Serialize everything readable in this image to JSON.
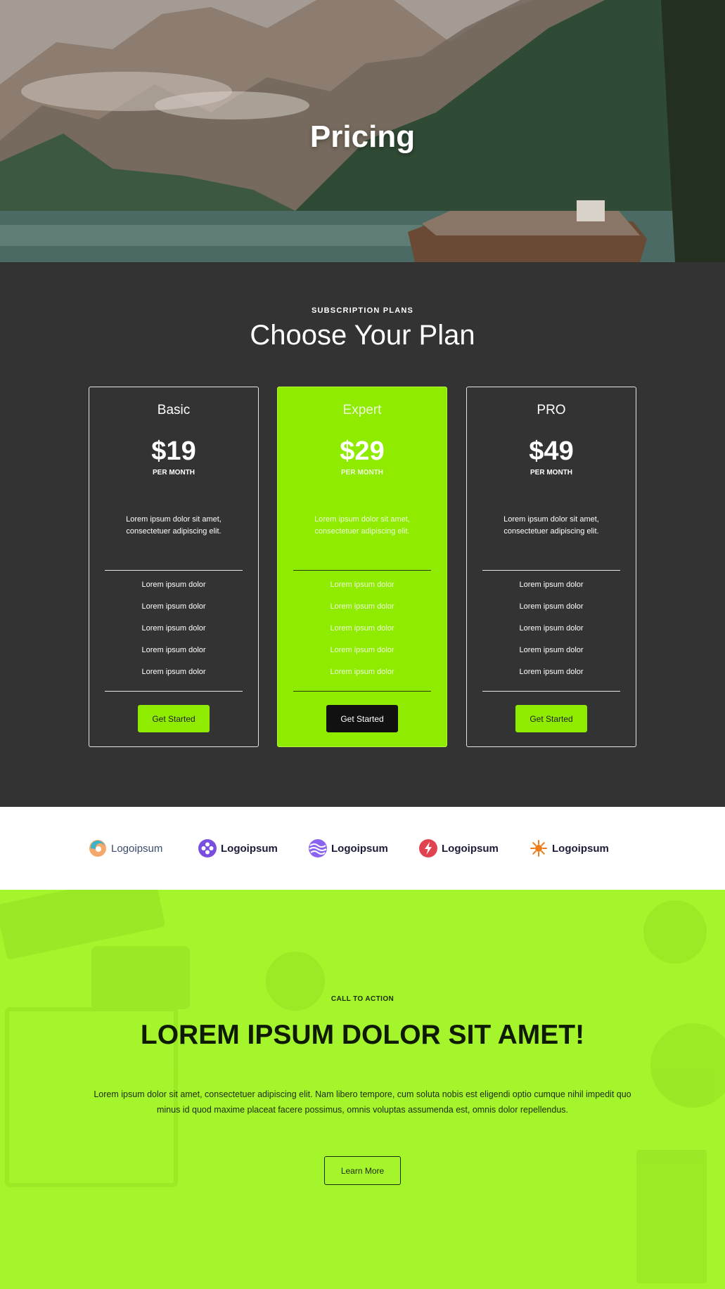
{
  "hero": {
    "title": "Pricing"
  },
  "pricing": {
    "eyebrow": "SUBSCRIPTION PLANS",
    "heading": "Choose Your Plan",
    "plans": [
      {
        "name": "Basic",
        "price": "$19",
        "period": "PER MONTH",
        "description": "Lorem ipsum dolor sit amet, consectetuer adipiscing elit.",
        "features": [
          "Lorem ipsum dolor",
          "Lorem ipsum dolor",
          "Lorem ipsum dolor",
          "Lorem ipsum dolor",
          "Lorem ipsum dolor"
        ],
        "button": "Get Started"
      },
      {
        "name": "Expert",
        "price": "$29",
        "period": "PER MONTH",
        "description": "Lorem ipsum dolor sit amet, consectetuer adipiscing elit.",
        "features": [
          "Lorem ipsum dolor",
          "Lorem ipsum dolor",
          "Lorem ipsum dolor",
          "Lorem ipsum dolor",
          "Lorem ipsum dolor"
        ],
        "button": "Get Started"
      },
      {
        "name": "PRO",
        "price": "$49",
        "period": "PER MONTH",
        "description": "Lorem ipsum dolor sit amet, consectetuer adipiscing elit.",
        "features": [
          "Lorem ipsum dolor",
          "Lorem ipsum dolor",
          "Lorem ipsum dolor",
          "Lorem ipsum dolor",
          "Lorem ipsum dolor"
        ],
        "button": "Get Started"
      }
    ]
  },
  "logos": [
    {
      "text": "Logoipsum",
      "icon": "swirl-logo-icon"
    },
    {
      "text": "Logoipsum",
      "icon": "dots-logo-icon"
    },
    {
      "text": "Logoipsum",
      "icon": "waves-logo-icon"
    },
    {
      "text": "Logoipsum",
      "icon": "bolt-logo-icon"
    },
    {
      "text": "Logoipsum",
      "icon": "sun-logo-icon"
    }
  ],
  "cta": {
    "eyebrow": "CALL TO ACTION",
    "heading": "LOREM IPSUM DOLOR SIT AMET!",
    "paragraph": "Lorem ipsum dolor sit amet, consectetuer adipiscing elit. Nam libero tempore, cum soluta nobis est eligendi optio cumque nihil impedit quo minus id quod maxime placeat facere possimus, omnis voluptas assumenda est, omnis dolor repellendus.",
    "button": "Learn More"
  },
  "colors": {
    "accent": "#8fec00",
    "dark": "#333333",
    "cta_bg": "#a4f52c"
  }
}
